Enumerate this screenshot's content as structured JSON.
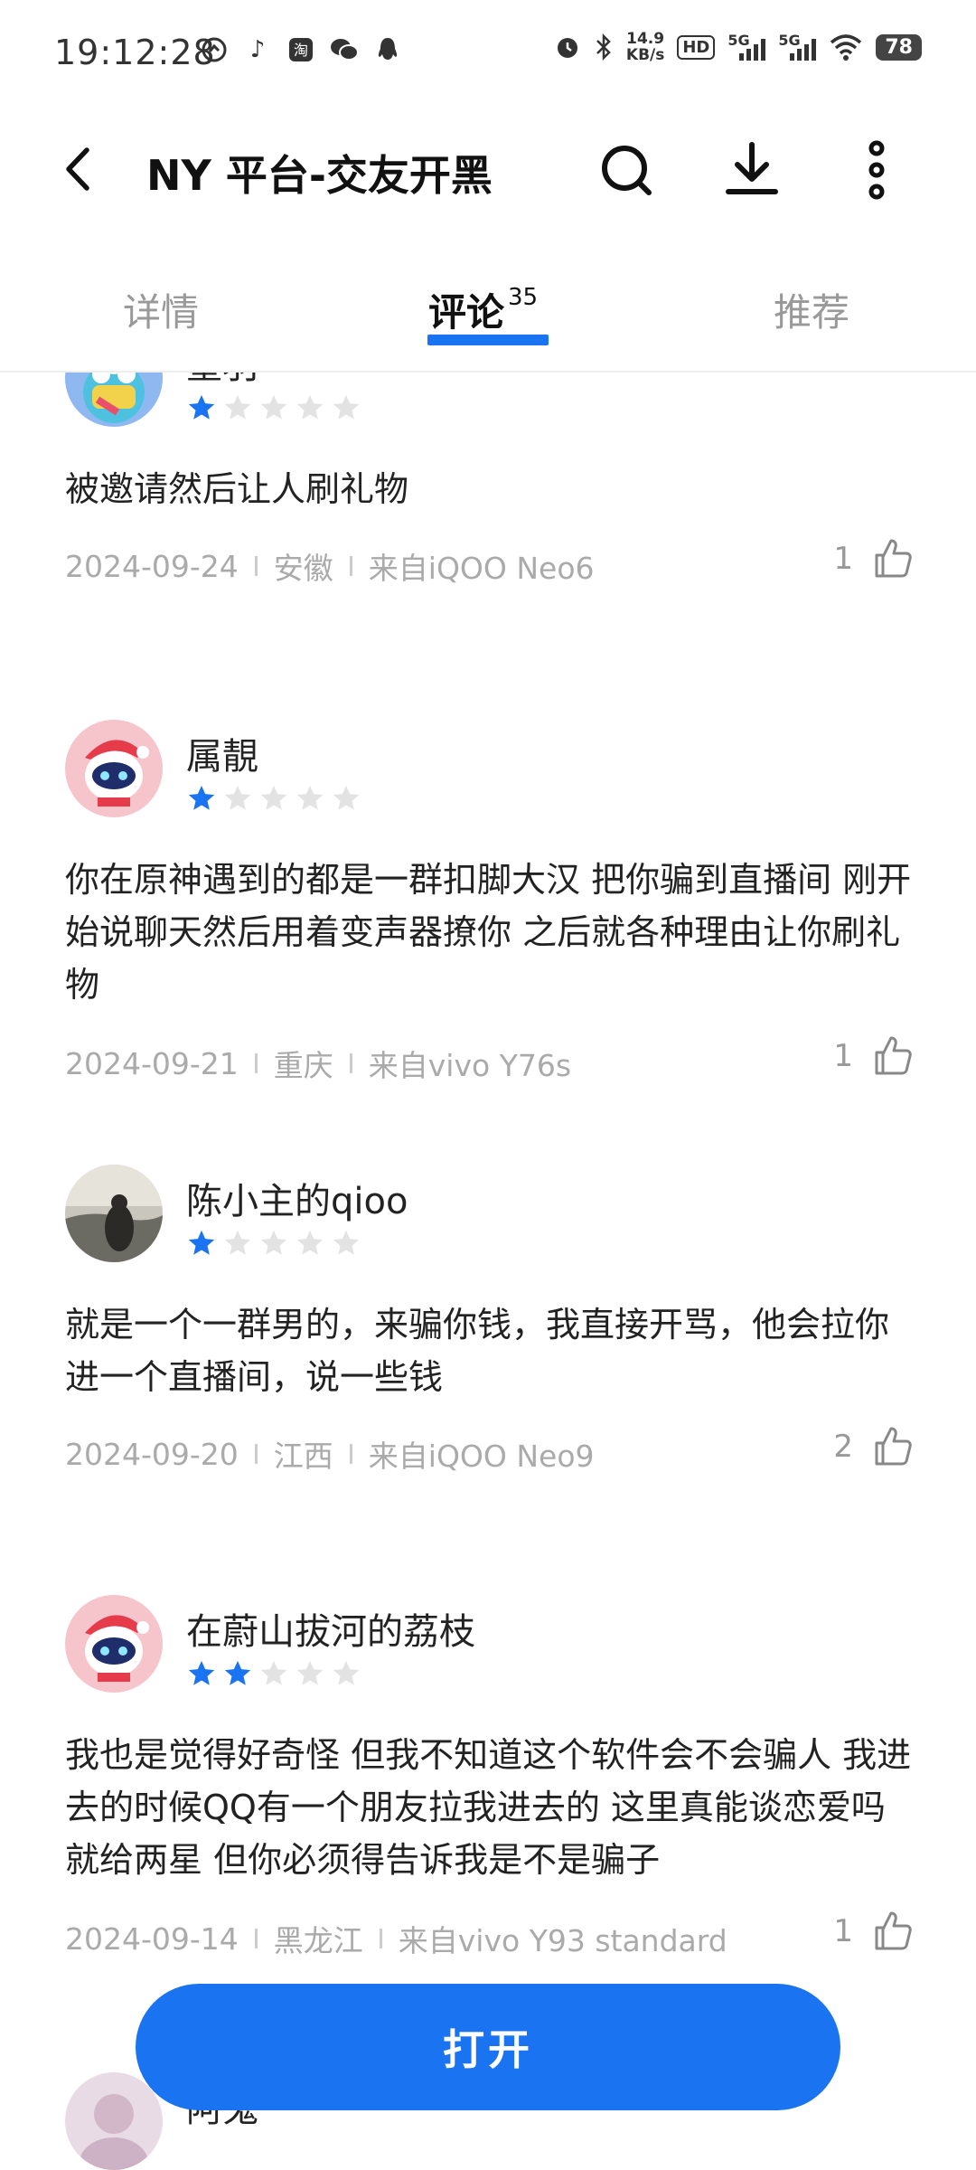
{
  "status_bar": {
    "time": "19:12:28",
    "app_icons": [
      "music-app-icon",
      "tiktok-icon",
      "taobao-icon",
      "wechat-icon",
      "qq-icon"
    ],
    "speed_value": "14.9",
    "speed_unit": "KB/s",
    "hd_label": "HD",
    "signal_1": "5G",
    "signal_2": "5G",
    "battery": "78"
  },
  "header": {
    "title": "NY 平台-交友开黑"
  },
  "tabs": [
    {
      "label": "详情"
    },
    {
      "label": "评论",
      "count": "35"
    },
    {
      "label": "推荐"
    }
  ],
  "reviews": [
    {
      "user": "墨羽",
      "rating": 1,
      "text": "被邀请然后让人刷礼物",
      "date": "2024-09-24",
      "region": "安徽",
      "device": "来自iQOO Neo6",
      "likes": "1"
    },
    {
      "user": "属靚",
      "rating": 1,
      "text": "你在原神遇到的都是一群扣脚大汉  把你骗到直播间 刚开始说聊天然后用着变声器撩你  之后就各种理由让你刷礼物",
      "date": "2024-09-21",
      "region": "重庆",
      "device": "来自vivo Y76s",
      "likes": "1"
    },
    {
      "user": "陈小主的qioo",
      "rating": 1,
      "text": "就是一个一群男的，来骗你钱，我直接开骂，他会拉你进一个直播间，说一些钱",
      "date": "2024-09-20",
      "region": "江西",
      "device": "来自iQOO Neo9",
      "likes": "2"
    },
    {
      "user": "在蔚山拔河的荔枝",
      "rating": 2,
      "text": "我也是觉得好奇怪 但我不知道这个软件会不会骗人 我进去的时候QQ有一个朋友拉我进去的 这里真能谈恋爱吗 就给两星 但你必须得告诉我是不是骗子",
      "date": "2024-09-14",
      "region": "黑龙江",
      "device": "来自vivo Y93 standard",
      "likes": "1"
    },
    {
      "user": "阿鬼"
    }
  ],
  "open_button": "打开",
  "colors": {
    "accent": "#1a73f0",
    "star_empty": "#e3e3e3",
    "meta": "#aaaaaa"
  }
}
